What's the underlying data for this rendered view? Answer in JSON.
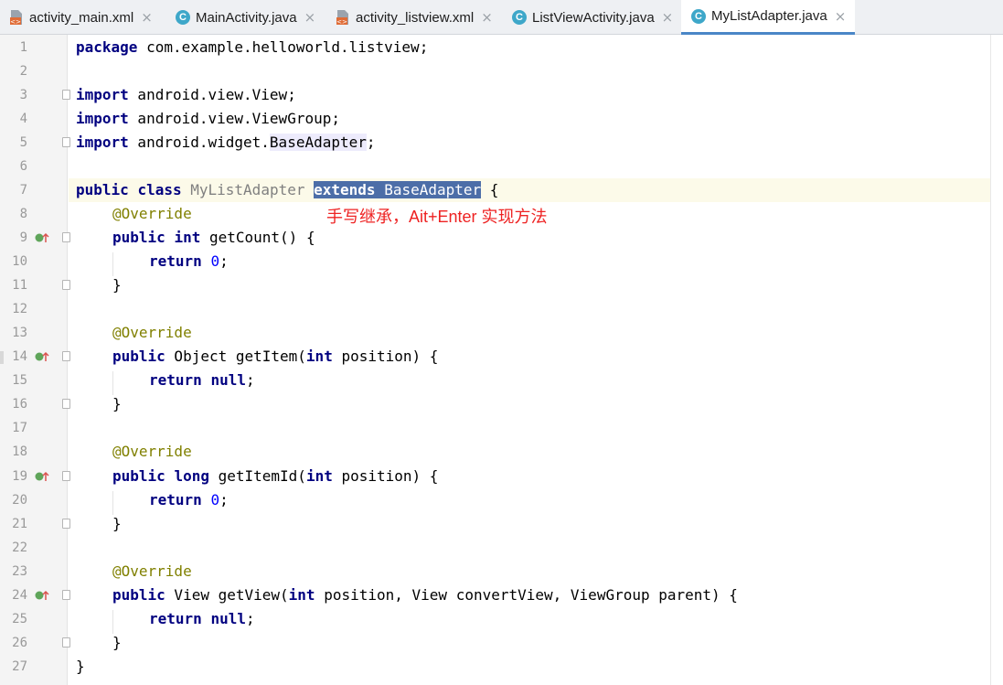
{
  "tabs": [
    {
      "label": "activity_main.xml",
      "icon": "xml-file-icon",
      "active": false
    },
    {
      "label": "MainActivity.java",
      "icon": "java-class-icon",
      "active": false
    },
    {
      "label": "activity_listview.xml",
      "icon": "xml-file-icon",
      "active": false
    },
    {
      "label": "ListViewActivity.java",
      "icon": "java-class-icon",
      "active": false
    },
    {
      "label": "MyListAdapter.java",
      "icon": "java-class-icon",
      "active": true
    }
  ],
  "close_glyph": "×",
  "line_numbers": [
    "1",
    "2",
    "3",
    "4",
    "5",
    "6",
    "7",
    "8",
    "9",
    "10",
    "11",
    "12",
    "13",
    "14",
    "15",
    "16",
    "17",
    "18",
    "19",
    "20",
    "21",
    "22",
    "23",
    "24",
    "25",
    "26",
    "27"
  ],
  "code": {
    "l1_kw": "package",
    "l1_rest": " com.example.helloworld.listview;",
    "l3_kw": "import",
    "l3_rest": " android.view.View;",
    "l4_kw": "import",
    "l4_rest": " android.view.ViewGroup;",
    "l5_kw": "import",
    "l5_pre": " android.widget.",
    "l5_hl": "BaseAdapter",
    "l5_post": ";",
    "l7_public": "public",
    "l7_class": "class",
    "l7_name": "MyListAdapter",
    "l7_extends": "extends",
    "l7_base": "BaseAdapter",
    "l7_brace": " {",
    "override": "@Override",
    "public": "public",
    "int": "int",
    "long": "long",
    "return": "return",
    "null": "null",
    "zero": "0",
    "semi": ";",
    "close_brace": "}",
    "l9_rest": " getCount() {",
    "l14_a": " Object getItem(",
    "l14_b": " position) {",
    "l19_a": " getItemId(",
    "l19_b": " position) {",
    "l24_a": " View getView(",
    "l24_b": " position, View convertView, ViewGroup parent) {"
  },
  "annotation_note": "手写继承，Ait+Enter 实现方法",
  "colors": {
    "keyword": "#000080",
    "annotation": "#808000",
    "number": "#0000ff",
    "note": "#ee2222",
    "tab_active_underline": "#4a86c7"
  }
}
